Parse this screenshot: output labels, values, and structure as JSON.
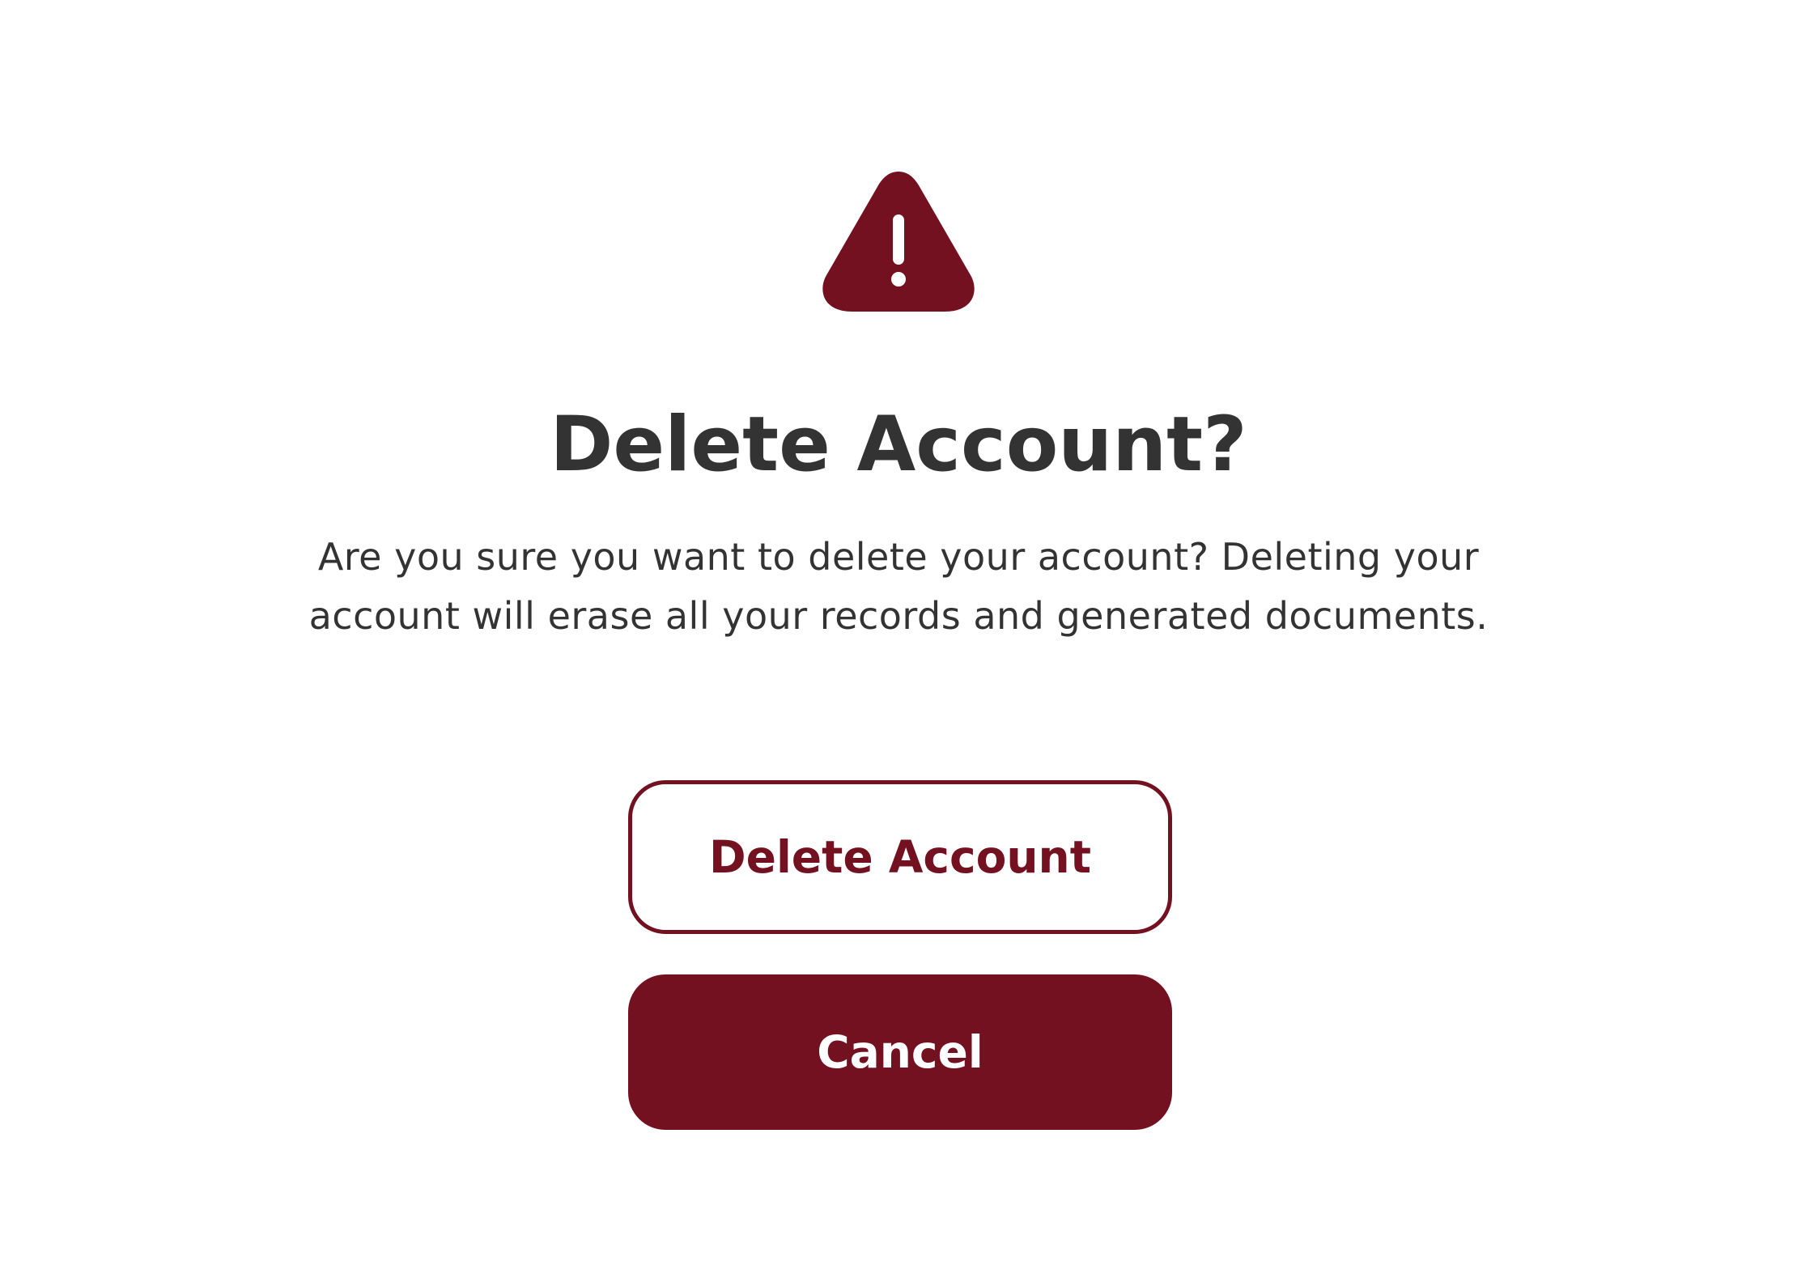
{
  "dialog": {
    "icon": "warning-triangle-icon",
    "title": "Delete Account?",
    "message_lines": [
      "Are you sure you want to delete your account? Deleting your",
      "account will erase all your records and generated documents."
    ],
    "delete_label": "Delete Account",
    "cancel_label": "Cancel"
  },
  "colors": {
    "accent": "#731121",
    "text": "#333333",
    "background": "#ffffff"
  }
}
